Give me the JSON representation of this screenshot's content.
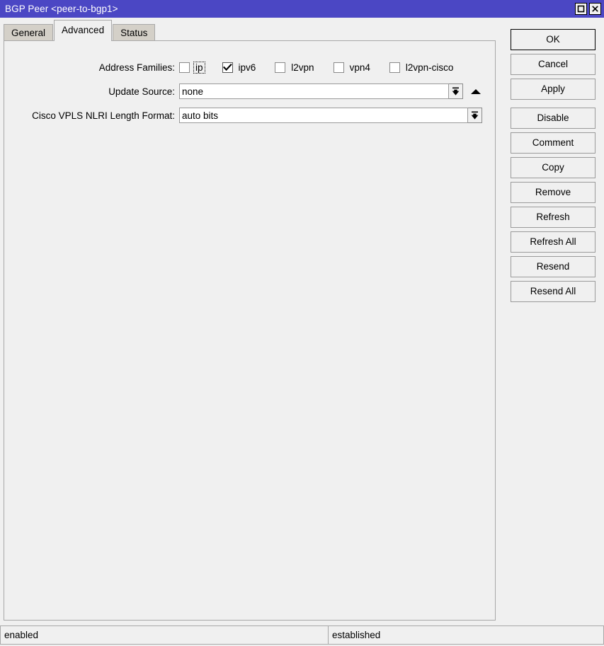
{
  "window": {
    "title": "BGP Peer <peer-to-bgp1>",
    "maximize_icon": "maximize-icon",
    "close_icon": "close-icon"
  },
  "tabs": [
    {
      "label": "General",
      "active": false
    },
    {
      "label": "Advanced",
      "active": true
    },
    {
      "label": "Status",
      "active": false
    }
  ],
  "form": {
    "address_families": {
      "label": "Address Families:",
      "options": [
        {
          "label": "ip",
          "checked": false,
          "focused": true
        },
        {
          "label": "ipv6",
          "checked": true,
          "focused": false
        },
        {
          "label": "l2vpn",
          "checked": false,
          "focused": false
        },
        {
          "label": "vpn4",
          "checked": false,
          "focused": false
        },
        {
          "label": "l2vpn-cisco",
          "checked": false,
          "focused": false
        }
      ]
    },
    "update_source": {
      "label": "Update Source:",
      "value": "none",
      "dropdown_icon": "dropdown-arrow-icon",
      "collapse_icon": "collapse-up-arrow-icon"
    },
    "cisco_vpls_nlri": {
      "label": "Cisco VPLS NLRI Length Format:",
      "value": "auto bits",
      "dropdown_icon": "dropdown-arrow-icon"
    }
  },
  "buttons": [
    {
      "label": "OK",
      "default": true,
      "gap_after": false
    },
    {
      "label": "Cancel",
      "default": false,
      "gap_after": false
    },
    {
      "label": "Apply",
      "default": false,
      "gap_after": true
    },
    {
      "label": "Disable",
      "default": false,
      "gap_after": false
    },
    {
      "label": "Comment",
      "default": false,
      "gap_after": false
    },
    {
      "label": "Copy",
      "default": false,
      "gap_after": false
    },
    {
      "label": "Remove",
      "default": false,
      "gap_after": false
    },
    {
      "label": "Refresh",
      "default": false,
      "gap_after": false
    },
    {
      "label": "Refresh All",
      "default": false,
      "gap_after": false
    },
    {
      "label": "Resend",
      "default": false,
      "gap_after": false
    },
    {
      "label": "Resend All",
      "default": false,
      "gap_after": false
    }
  ],
  "statusbar": {
    "left": "enabled",
    "right": "established"
  },
  "colors": {
    "titlebar": "#4b47c4",
    "titlebar_text": "#ffffff",
    "window_bg": "#f0f0f0",
    "tab_inactive": "#d4d0c8",
    "border": "#a8a8a8",
    "input_bg": "#ffffff"
  }
}
